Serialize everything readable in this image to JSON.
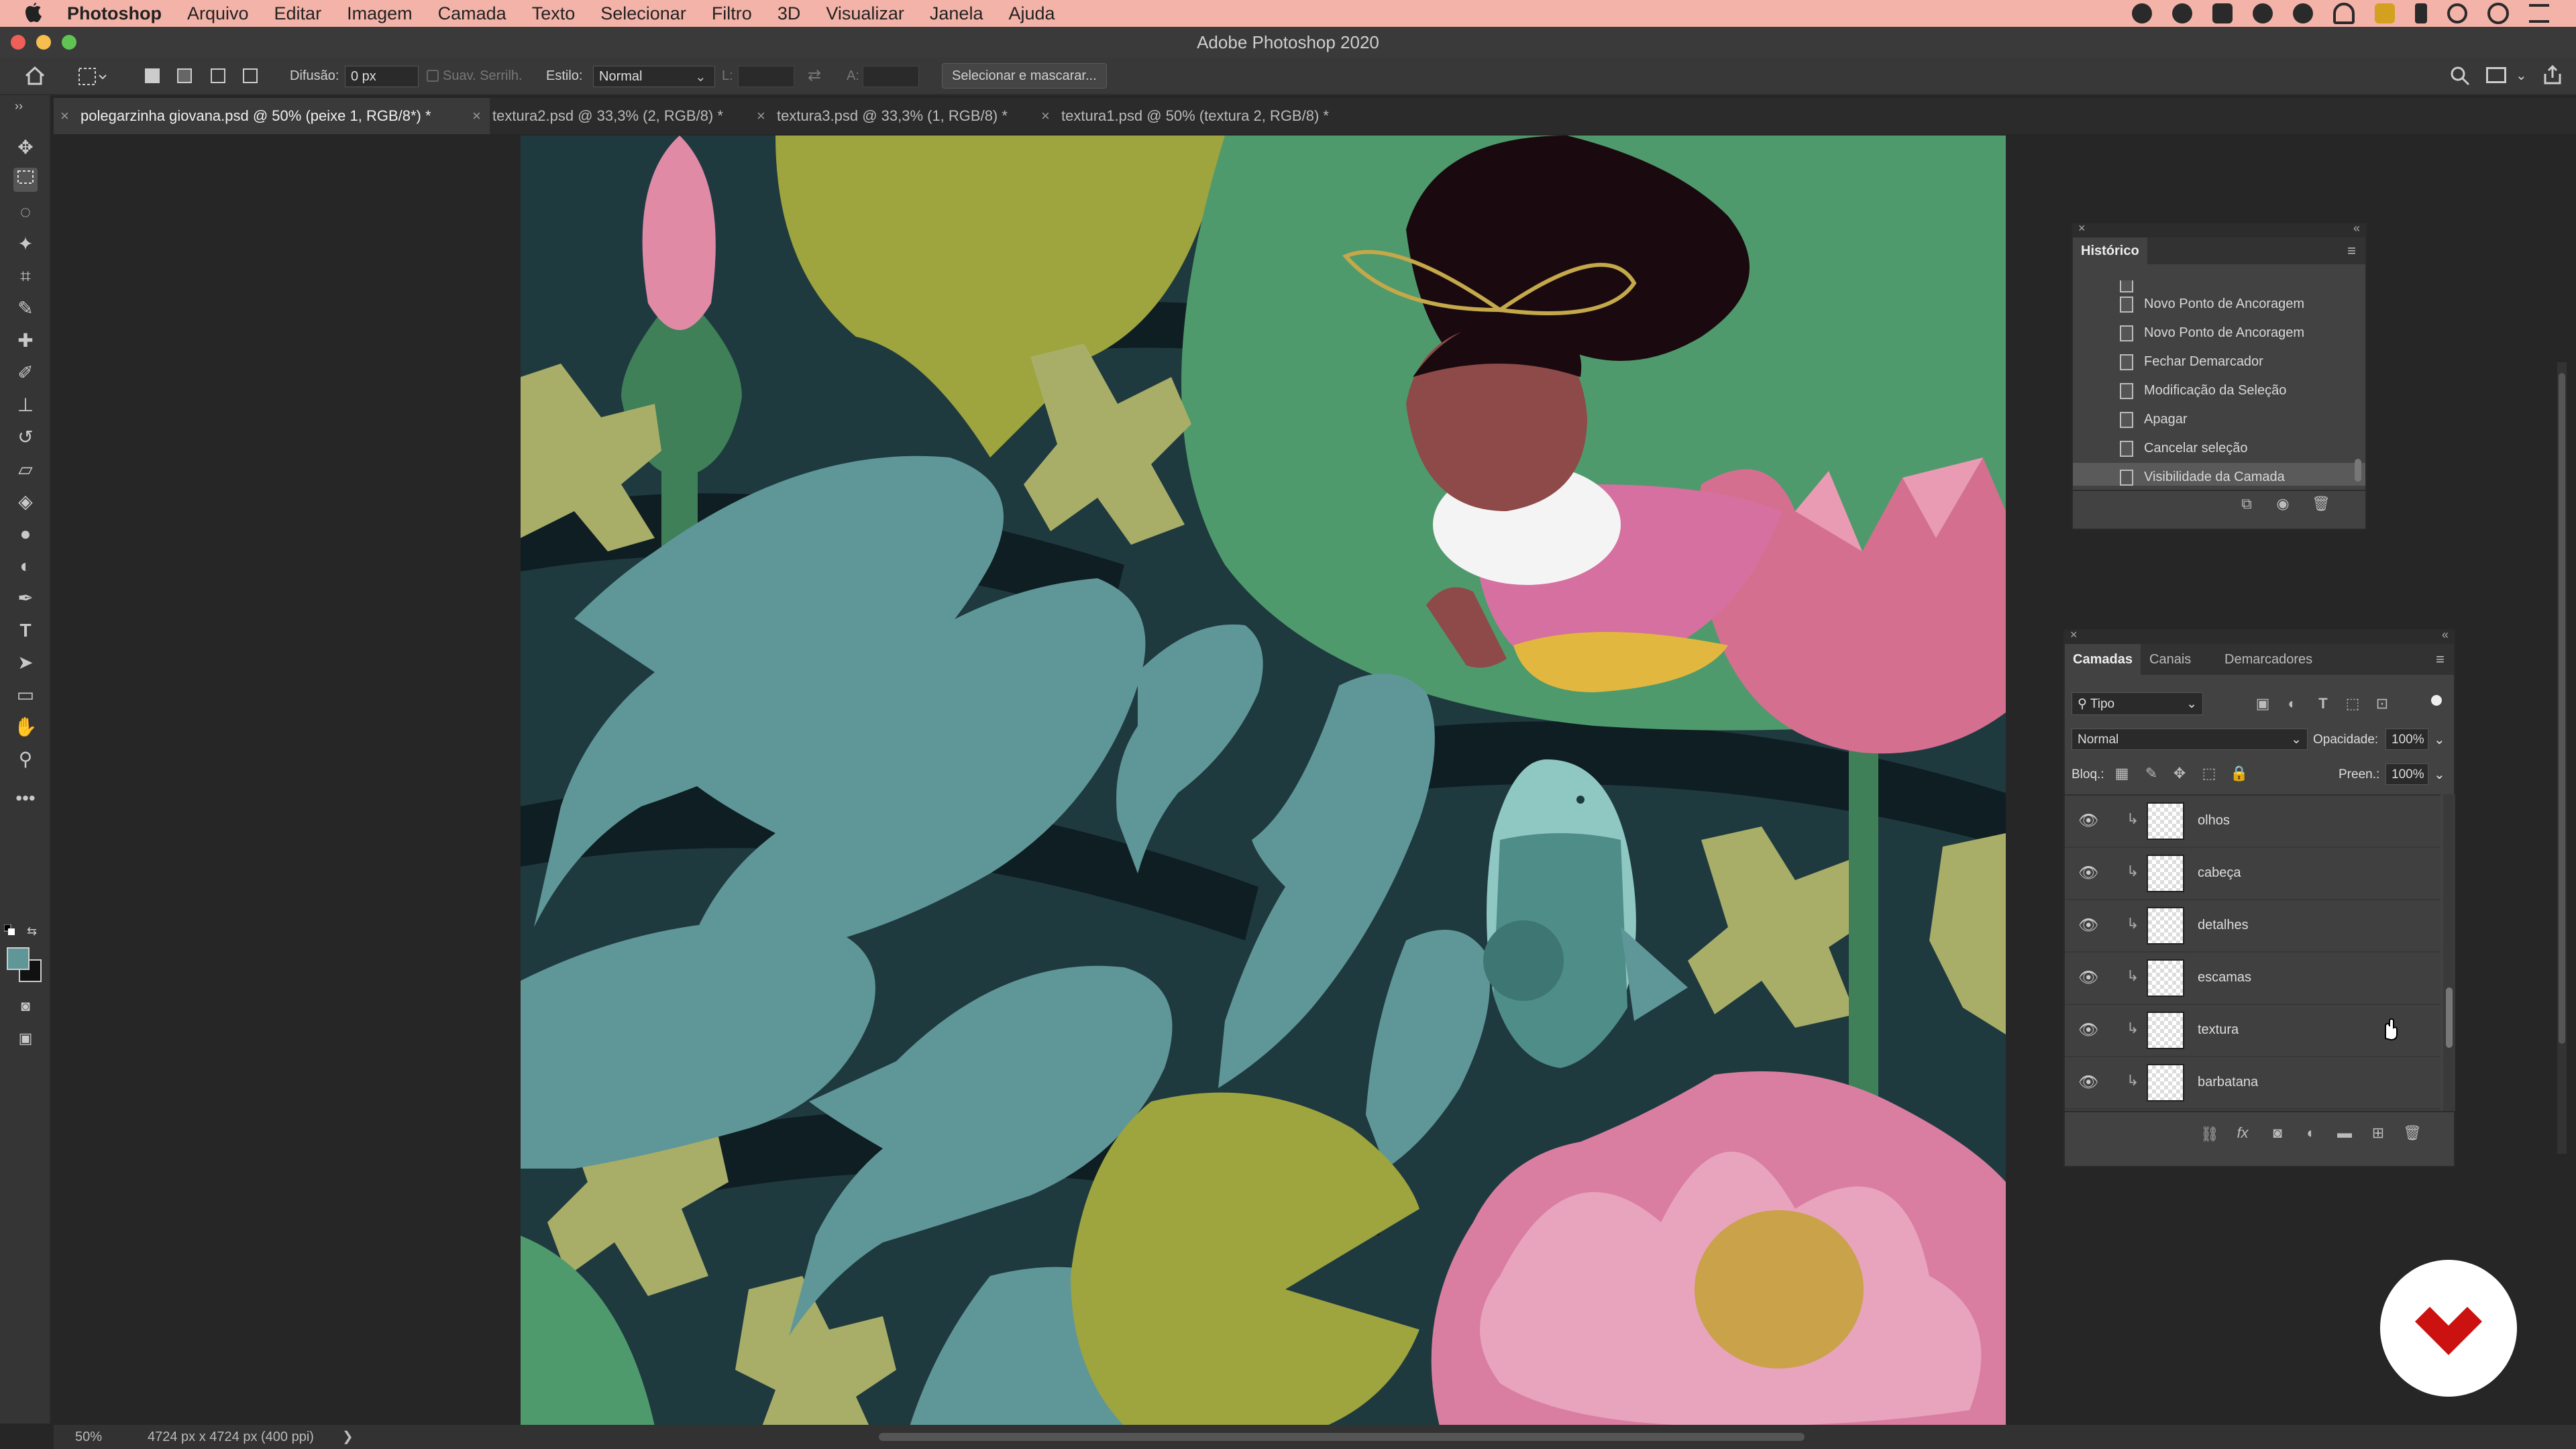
{
  "menubar": {
    "apple": "",
    "app": "Photoshop",
    "items": [
      "Arquivo",
      "Editar",
      "Imagem",
      "Camada",
      "Texto",
      "Selecionar",
      "Filtro",
      "3D",
      "Visualizar",
      "Janela",
      "Ajuda"
    ]
  },
  "window": {
    "title": "Adobe Photoshop 2020"
  },
  "options": {
    "feather_label": "Difusão:",
    "feather_value": "0 px",
    "antialias_label": "Suav. Serrilh.",
    "style_label": "Estilo:",
    "style_value": "Normal",
    "width_label": "L:",
    "height_label": "A:",
    "select_mask_button": "Selecionar e mascarar..."
  },
  "tabs": [
    {
      "label": "polegarzinha giovana.psd @ 50% (peixe 1, RGB/8*) *",
      "active": true
    },
    {
      "label": "textura2.psd @ 33,3% (2, RGB/8) *",
      "active": false
    },
    {
      "label": "textura3.psd @ 33,3% (1, RGB/8) *",
      "active": false
    },
    {
      "label": "textura1.psd @ 50% (textura 2, RGB/8) *",
      "active": false
    }
  ],
  "status": {
    "zoom": "50%",
    "doc_size": "4724 px x 4724 px (400 ppi)",
    "arrow": "❯"
  },
  "history": {
    "title": "Histórico",
    "items": [
      "Novo Ponto de Ancoragem",
      "Novo Ponto de Ancoragem",
      "Fechar Demarcador",
      "Modificação da Seleção",
      "Apagar",
      "Cancelar seleção",
      "Visibilidade da Camada"
    ]
  },
  "layers": {
    "tabs": [
      "Camadas",
      "Canais",
      "Demarcadores"
    ],
    "filter_value": "Tipo",
    "blend_mode": "Normal",
    "opacity_label": "Opacidade:",
    "opacity_value": "100%",
    "lock_label": "Bloq.:",
    "fill_label": "Preen.:",
    "fill_value": "100%",
    "items": [
      "olhos",
      "cabeça",
      "detalhes",
      "escamas",
      "textura",
      "barbatana"
    ]
  },
  "colors": {
    "menubar": "#f3b3a8",
    "canvas_dark": "#1f3a3f",
    "fish": "#5f9799",
    "lily_green": "#4f9a6c",
    "olive": "#9ea43e",
    "pink": "#d97ea0",
    "accent_red": "#cc1111"
  }
}
